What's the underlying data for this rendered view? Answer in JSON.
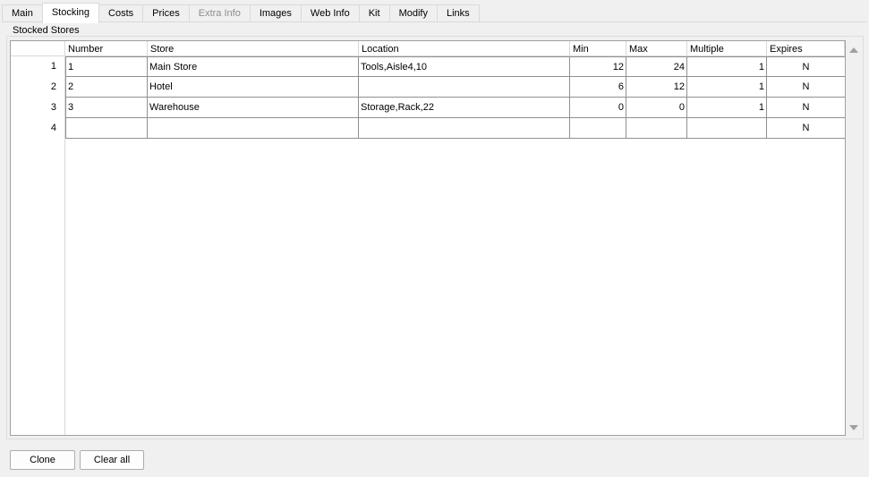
{
  "tabs": [
    {
      "label": "Main",
      "state": "normal"
    },
    {
      "label": "Stocking",
      "state": "active"
    },
    {
      "label": "Costs",
      "state": "normal"
    },
    {
      "label": "Prices",
      "state": "normal"
    },
    {
      "label": "Extra Info",
      "state": "disabled"
    },
    {
      "label": "Images",
      "state": "normal"
    },
    {
      "label": "Web Info",
      "state": "normal"
    },
    {
      "label": "Kit",
      "state": "normal"
    },
    {
      "label": "Modify",
      "state": "normal"
    },
    {
      "label": "Links",
      "state": "normal"
    }
  ],
  "group": {
    "title": "Stocked Stores"
  },
  "table": {
    "columns": [
      "Number",
      "Store",
      "Location",
      "Min",
      "Max",
      "Multiple",
      "Expires"
    ],
    "row_headers": [
      "1",
      "2",
      "3",
      "4"
    ],
    "rows": [
      [
        "1",
        "Main Store",
        "Tools,Aisle4,10",
        "12",
        "24",
        "1",
        "N"
      ],
      [
        "2",
        "Hotel",
        "",
        "6",
        "12",
        "1",
        "N"
      ],
      [
        "3",
        "Warehouse",
        "Storage,Rack,22",
        "0",
        "0",
        "1",
        "N"
      ],
      [
        "",
        "",
        "",
        "",
        "",
        "",
        "N"
      ]
    ]
  },
  "scrollbar": {
    "up_icon": "scroll-up-arrow-icon",
    "down_icon": "scroll-down-arrow-icon"
  },
  "buttons": {
    "clone": "Clone",
    "clear_all": "Clear all"
  }
}
